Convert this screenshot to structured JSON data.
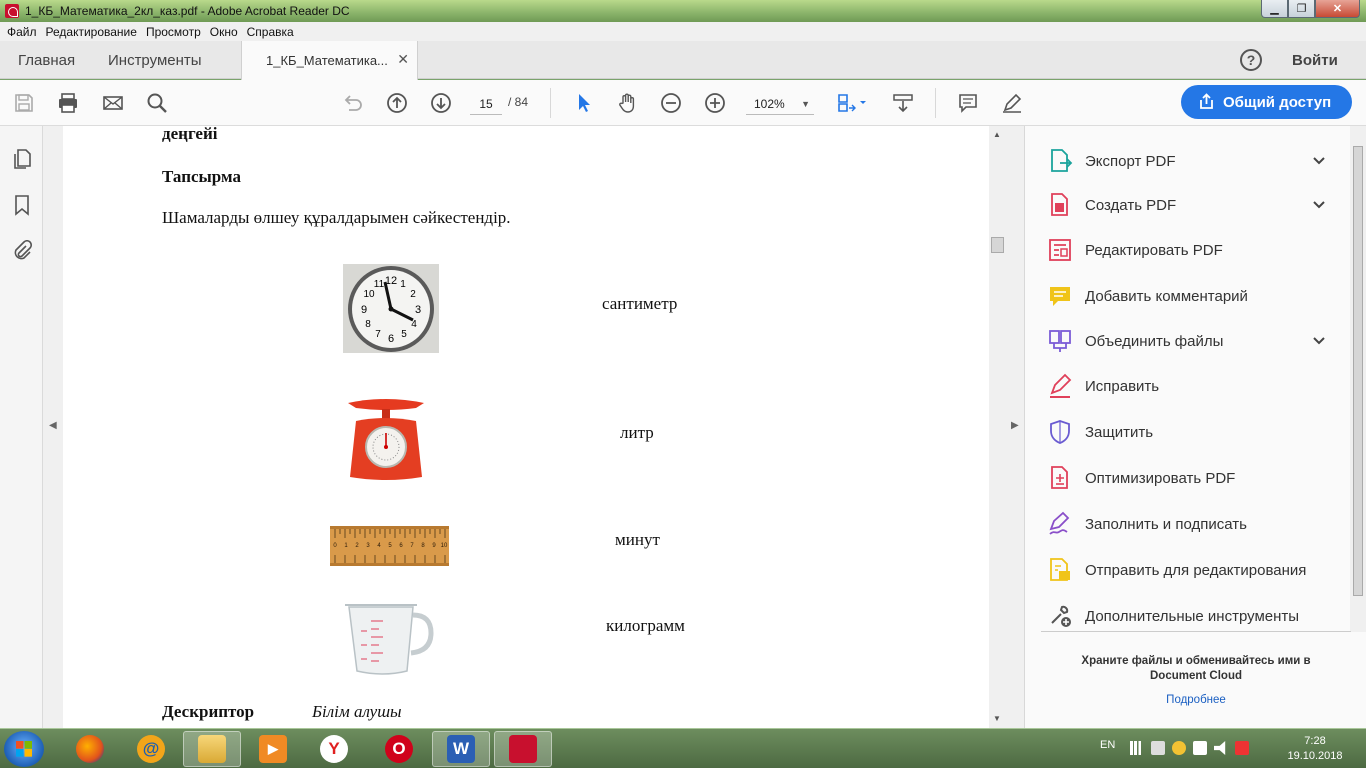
{
  "window": {
    "title": "1_КБ_Математика_2кл_каз.pdf - Adobe Acrobat Reader DC",
    "minimize": "▁",
    "maximize": "❐",
    "close": "✕"
  },
  "menu": [
    "Файл",
    "Редактирование",
    "Просмотр",
    "Окно",
    "Справка"
  ],
  "tabs": {
    "home": "Главная",
    "tools": "Инструменты",
    "document": "1_КБ_Математика...",
    "close": "✕",
    "help": "?",
    "signin": "Войти"
  },
  "toolbar": {
    "page_current": "15",
    "page_total": "/ 84",
    "zoom": "102%",
    "share_label": "Общий доступ"
  },
  "document": {
    "level_heading": "деңгейі",
    "task_heading": "Тапсырма",
    "instruction": "Шамаларды өлшеу құралдарымен сәйкестендір.",
    "words": [
      "сантиметр",
      "литр",
      "минут",
      "килограмм"
    ],
    "clock_numbers": [
      "12",
      "1",
      "2",
      "3",
      "4",
      "5",
      "6",
      "7",
      "8",
      "9",
      "10",
      "11"
    ],
    "ruler_numbers": [
      "0",
      "1",
      "2",
      "3",
      "4",
      "5",
      "6",
      "7",
      "8",
      "9",
      "10"
    ],
    "descriptor_label": "Дескриптор",
    "descriptor_text": "Білім алушы"
  },
  "tools_panel": {
    "items": [
      {
        "label": "Экспорт PDF",
        "icon": "export-pdf-icon",
        "color": "#1ba39c",
        "expandable": true
      },
      {
        "label": "Создать PDF",
        "icon": "create-pdf-icon",
        "color": "#e0405a",
        "expandable": true
      },
      {
        "label": "Редактировать PDF",
        "icon": "edit-pdf-icon",
        "color": "#e0405a",
        "expandable": false
      },
      {
        "label": "Добавить комментарий",
        "icon": "comment-icon",
        "color": "#f0c419",
        "expandable": false
      },
      {
        "label": "Объединить файлы",
        "icon": "combine-files-icon",
        "color": "#7b5cd6",
        "expandable": true
      },
      {
        "label": "Исправить",
        "icon": "fix-pen-icon",
        "color": "#e0405a",
        "expandable": false
      },
      {
        "label": "Защитить",
        "icon": "shield-icon",
        "color": "#6a5bd1",
        "expandable": false
      },
      {
        "label": "Оптимизировать PDF",
        "icon": "optimize-pdf-icon",
        "color": "#e0405a",
        "expandable": false
      },
      {
        "label": "Заполнить и подписать",
        "icon": "fill-sign-icon",
        "color": "#8a4fc9",
        "expandable": false
      },
      {
        "label": "Отправить для редактирования",
        "icon": "send-review-icon",
        "color": "#f0c419",
        "expandable": false
      },
      {
        "label": "Дополнительные инструменты",
        "icon": "more-tools-icon",
        "color": "#555555",
        "expandable": false
      }
    ],
    "cloud_text": "Храните файлы и обменивайтесь ими в Document Cloud",
    "cloud_link": "Подробнее"
  },
  "taskbar": {
    "language": "EN",
    "time": "7:28",
    "date": "19.10.2018",
    "apps": [
      {
        "name": "firefox",
        "glyph": ""
      },
      {
        "name": "email",
        "glyph": "@"
      },
      {
        "name": "explorer",
        "glyph": ""
      },
      {
        "name": "media-player",
        "glyph": "▶"
      },
      {
        "name": "yandex",
        "glyph": "Y"
      },
      {
        "name": "opera",
        "glyph": "O"
      },
      {
        "name": "word",
        "glyph": "W"
      },
      {
        "name": "acrobat",
        "glyph": ""
      }
    ]
  },
  "colors": {
    "accent": "#2477e6",
    "title_bar": "#8ab36a",
    "link": "#1a5fc2"
  }
}
